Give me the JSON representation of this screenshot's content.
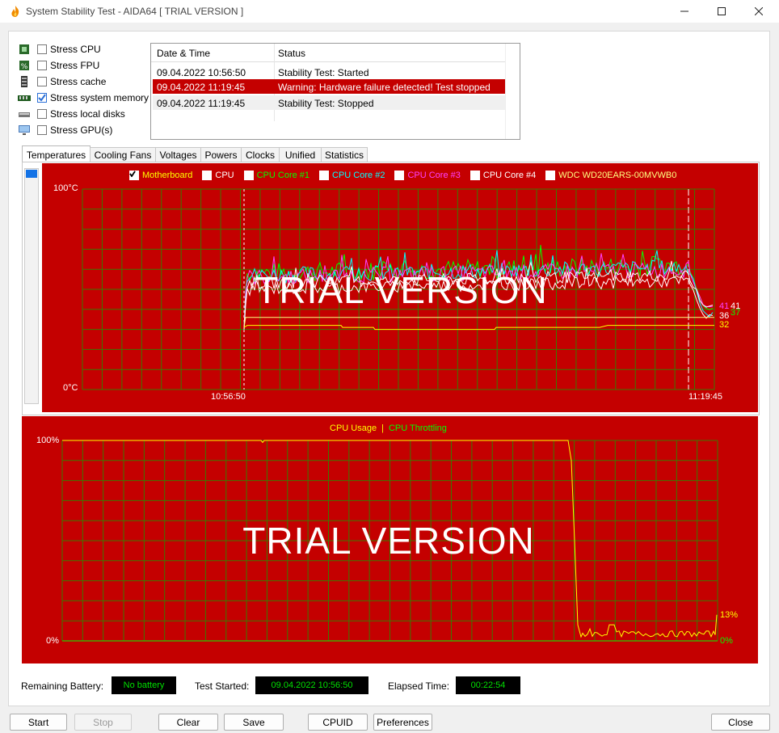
{
  "window": {
    "title": "System Stability Test - AIDA64  [ TRIAL VERSION ]"
  },
  "stress_options": [
    {
      "label": "Stress CPU",
      "checked": false,
      "icon": "cpu-chip-icon"
    },
    {
      "label": "Stress FPU",
      "checked": false,
      "icon": "fpu-chip-icon"
    },
    {
      "label": "Stress cache",
      "checked": false,
      "icon": "cache-icon"
    },
    {
      "label": "Stress system memory",
      "checked": true,
      "icon": "memory-module-icon"
    },
    {
      "label": "Stress local disks",
      "checked": false,
      "icon": "disk-icon"
    },
    {
      "label": "Stress GPU(s)",
      "checked": false,
      "icon": "gpu-monitor-icon"
    }
  ],
  "log": {
    "headers": {
      "datetime": "Date & Time",
      "status": "Status"
    },
    "rows": [
      {
        "datetime": "09.04.2022 10:56:50",
        "status": "Stability Test: Started"
      },
      {
        "datetime": "09.04.2022 11:19:45",
        "status": "Warning: Hardware failure detected! Test stopped"
      },
      {
        "datetime": "09.04.2022 11:19:45",
        "status": "Stability Test: Stopped"
      }
    ]
  },
  "tabs": [
    "Temperatures",
    "Cooling Fans",
    "Voltages",
    "Powers",
    "Clocks",
    "Unified",
    "Statistics"
  ],
  "colors": {
    "chart_bg": "#c40000",
    "grid": "#3a7a00",
    "motherboard": "#ffff00",
    "cpu": "#ffffff",
    "core1": "#00ff00",
    "core2": "#00ffff",
    "core3": "#ff40ff",
    "core4": "#ffffff",
    "disk": "#ffff80",
    "usage": "#ffff00",
    "throttling": "#00ff00"
  },
  "temp_chart": {
    "legend": [
      {
        "label": "Motherboard",
        "color": "#ffff00"
      },
      {
        "label": "CPU",
        "color": "#ffffff"
      },
      {
        "label": "CPU Core #1",
        "color": "#00ff00"
      },
      {
        "label": "CPU Core #2",
        "color": "#00ffff"
      },
      {
        "label": "CPU Core #3",
        "color": "#ff40ff"
      },
      {
        "label": "CPU Core #4",
        "color": "#ffffff"
      },
      {
        "label": "WDC WD20EARS-00MVWB0",
        "color": "#ffff80"
      }
    ],
    "ymax_label": "100°C",
    "ymin_label": "0°C",
    "x_start_label": "10:56:50",
    "x_end_label": "11:19:45",
    "watermark": "TRIAL VERSION",
    "end_values": [
      "41",
      "41",
      "36",
      "37",
      "32"
    ]
  },
  "usage_chart": {
    "legend_usage": "CPU Usage",
    "legend_sep": "|",
    "legend_throttling": "CPU Throttling",
    "ymax_label": "100%",
    "ymin_label": "0%",
    "watermark": "TRIAL VERSION",
    "end_usage": "13%",
    "end_throttling": "0%"
  },
  "chart_data": [
    {
      "type": "line",
      "ylim": [
        0,
        100
      ],
      "ylabel": "",
      "x": [
        "10:56:50",
        "11:19:45"
      ],
      "series": [
        {
          "name": "Motherboard",
          "end_value": 32
        },
        {
          "name": "CPU",
          "end_value": 41
        },
        {
          "name": "CPU Core #1",
          "end_value": 41
        },
        {
          "name": "CPU Core #2",
          "end_value": 37
        },
        {
          "name": "CPU Core #3",
          "end_value": 41
        },
        {
          "name": "CPU Core #4",
          "end_value": 36
        },
        {
          "name": "WDC WD20EARS-00MVWB0",
          "end_value": 36
        }
      ]
    },
    {
      "type": "line",
      "ylim": [
        0,
        100
      ],
      "series": [
        {
          "name": "CPU Usage",
          "end_value": 13
        },
        {
          "name": "CPU Throttling",
          "end_value": 0
        }
      ]
    }
  ],
  "status_bar": {
    "battery_label": "Remaining Battery:",
    "battery_value": "No battery",
    "started_label": "Test Started:",
    "started_value": "09.04.2022 10:56:50",
    "elapsed_label": "Elapsed Time:",
    "elapsed_value": "00:22:54"
  },
  "buttons": {
    "start": "Start",
    "stop": "Stop",
    "clear": "Clear",
    "save": "Save",
    "cpuid": "CPUID",
    "preferences": "Preferences",
    "close": "Close"
  }
}
